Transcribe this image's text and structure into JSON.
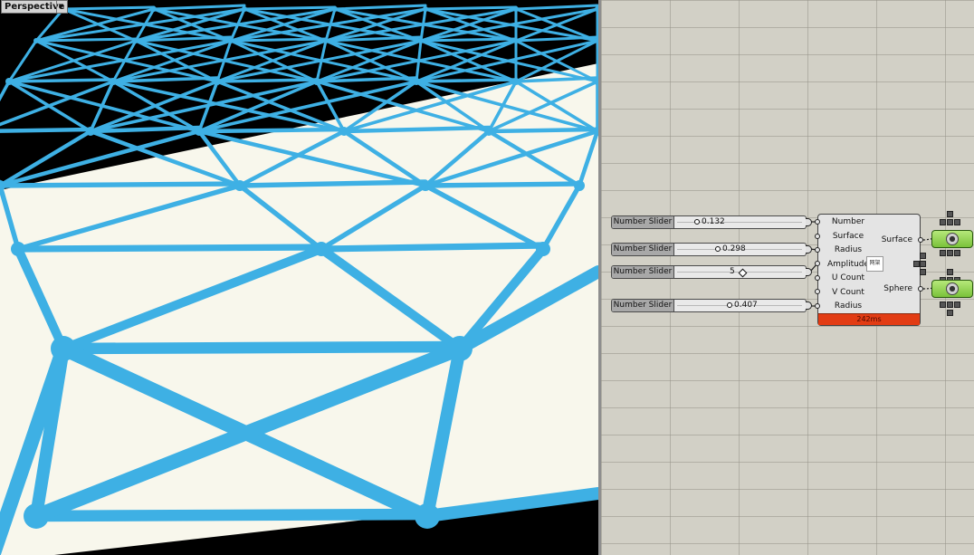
{
  "viewport": {
    "label": "Perspective",
    "background": "#000000",
    "surface_color": "#f8f7ec",
    "strut_color": "#3eb0e4"
  },
  "sliders": [
    {
      "label": "Number Slider",
      "value": "0.132",
      "marker": "circle"
    },
    {
      "label": "Number Slider",
      "value": "0.298",
      "marker": "circle"
    },
    {
      "label": "Number Slider",
      "value": "5",
      "marker": "diamond"
    },
    {
      "label": "Number Slider",
      "value": "0.407",
      "marker": "circle"
    }
  ],
  "component": {
    "inputs": [
      "Number",
      "Surface",
      "Radius",
      "Amplitude",
      "U Count",
      "V Count",
      "Radius"
    ],
    "outputs": [
      "Surface",
      "Sphere"
    ],
    "icon_label": "网架",
    "timing": "242ms",
    "timing_color": "#e23c14"
  },
  "outputs": [
    {
      "name": "surface-preview",
      "color": "#8fd44f"
    },
    {
      "name": "sphere-preview",
      "color": "#8fd44f"
    }
  ]
}
